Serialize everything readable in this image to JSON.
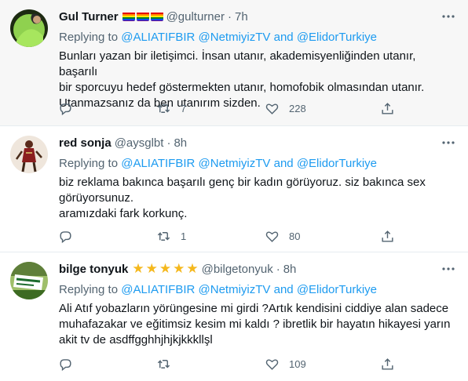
{
  "tweets": [
    {
      "name": "Gul Turner",
      "handle": "@gulturner",
      "dot": "·",
      "time": "7h",
      "replying_label": "Replying to",
      "mentions": [
        "@ALIATIFBIR",
        "@NetmiyizTV",
        "@ElidorTurkiye"
      ],
      "and_label": "and",
      "text_lines": [
        "Bunları yazan bir iletişimci. İnsan utanır, akademisyenliğinden utanır, başarılı",
        "bir sporcuyu hedef göstermekten utanır, homofobik olmasından utanır.",
        "Utanmazsanız da ben utanırım sizden."
      ],
      "retweets": "7",
      "likes": "228",
      "badges": [
        "rainbow-flag-icon",
        "rainbow-flag-icon",
        "rainbow-flag-icon"
      ]
    },
    {
      "name": "red sonja",
      "handle": "@aysglbt",
      "dot": "·",
      "time": "8h",
      "replying_label": "Replying to",
      "mentions": [
        "@ALIATIFBIR",
        "@NetmiyizTV",
        "@ElidorTurkiye"
      ],
      "and_label": "and",
      "text_lines": [
        "biz reklama bakınca başarılı genç bir kadın görüyoruz. siz bakınca sex",
        "görüyorsunuz.",
        "aramızdaki fark korkunç."
      ],
      "retweets": "1",
      "likes": "80"
    },
    {
      "name": "bilge tonyuk",
      "handle": "@bilgetonyuk",
      "dot": "·",
      "time": "8h",
      "replying_label": "Replying to",
      "mentions": [
        "@ALIATIFBIR",
        "@NetmiyizTV",
        "@ElidorTurkiye"
      ],
      "and_label": "and",
      "text_lines": [
        "Ali Atıf yobazların yörüngesine mi girdi ?Artık kendisini ciddiye alan sadece",
        "muhafazakar ve eğitimsiz kesim mi kaldı ? ibretlik bir hayatın hikayesi yarın",
        "akit tv de asdffgghhjhjkjkkkllşl"
      ],
      "retweets": "",
      "likes": "109",
      "stars": [
        "★",
        "★",
        "★",
        "★",
        "★"
      ]
    }
  ],
  "colors": {
    "mention": "#1d9bf0",
    "muted": "#536471",
    "text": "#0f1419",
    "star": "#f5b81d",
    "highlight_bg": "#f7f7f7"
  },
  "icons": {
    "more": "more-horizontal-icon",
    "reply": "reply-icon",
    "retweet": "retweet-icon",
    "like": "heart-icon",
    "share": "share-icon"
  }
}
